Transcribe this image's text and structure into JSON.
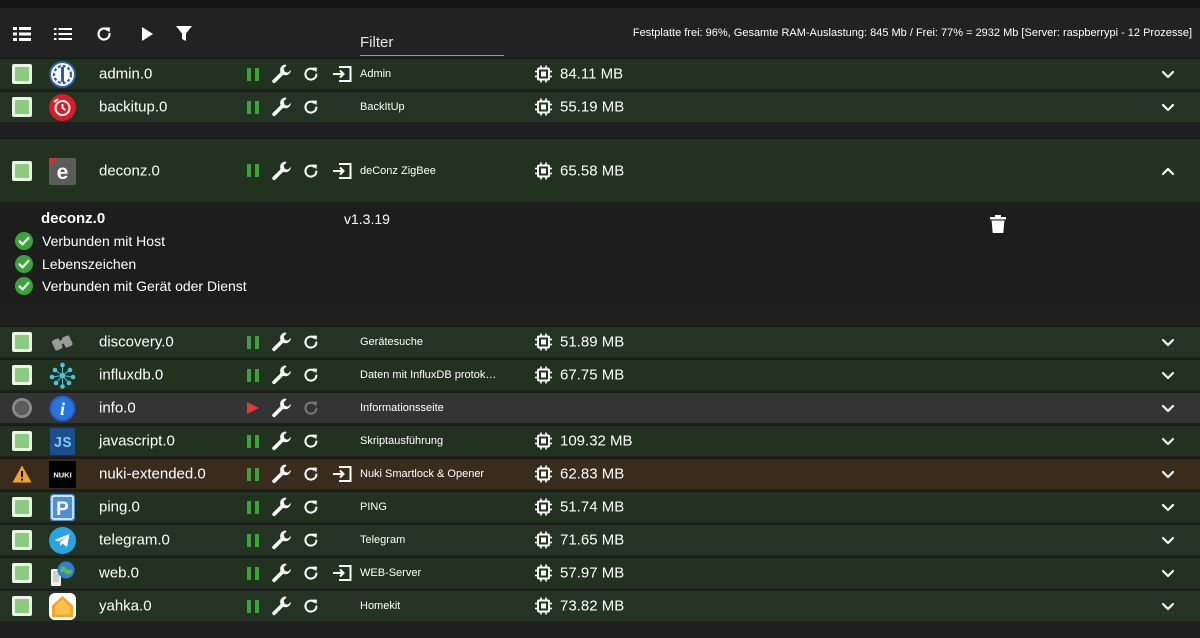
{
  "toolbar": {
    "icons": [
      "list-icon",
      "list-detail-icon",
      "refresh-icon",
      "play-icon",
      "filter-icon"
    ],
    "filter_placeholder": "Filter",
    "sysinfo": "Festplatte frei: 96%, Gesamte RAM-Auslastung: 845 Mb / Frei: 77% = 2932 Mb [Server: raspberrypi - 12 Prozesse]"
  },
  "colors": {
    "row_green": "#21321f",
    "row_green_alt": "#243323",
    "row_warning": "#3a2c1d",
    "row_disabled": "#343434",
    "status_green": "#3aa33a",
    "checkbox_green": "#8acb7f",
    "stop_red": "#e53935",
    "warning_orange": "#f0a22c"
  },
  "adapters": [
    {
      "name": "admin.0",
      "title": "Admin",
      "memory": "84.11 MB",
      "logo": "admin-logo-icon",
      "state": "running",
      "link": true
    },
    {
      "name": "backitup.0",
      "title": "BackItUp",
      "memory": "55.19 MB",
      "logo": "backitup-logo-icon",
      "state": "running",
      "link": false
    },
    {
      "name": "deconz.0",
      "title": "deConz ZigBee",
      "memory": "65.58 MB",
      "logo": "deconz-logo-icon",
      "state": "running",
      "link": true,
      "expanded": true
    },
    {
      "name": "discovery.0",
      "title": "Gerätesuche",
      "memory": "51.89 MB",
      "logo": "discovery-logo-icon",
      "state": "running",
      "link": false
    },
    {
      "name": "influxdb.0",
      "title": "Daten mit InfluxDB protokollieren",
      "memory": "67.75 MB",
      "logo": "influxdb-logo-icon",
      "state": "running",
      "link": false
    },
    {
      "name": "info.0",
      "title": "Informationsseite",
      "memory": "",
      "logo": "info-logo-icon",
      "state": "stopped",
      "link": false
    },
    {
      "name": "javascript.0",
      "title": "Skriptausführung",
      "memory": "109.32 MB",
      "logo": "javascript-logo-icon",
      "state": "running",
      "link": false
    },
    {
      "name": "nuki-extended.0",
      "title": "Nuki Smartlock & Opener",
      "memory": "62.83 MB",
      "logo": "nuki-logo-icon",
      "state": "warning",
      "link": true
    },
    {
      "name": "ping.0",
      "title": "PING",
      "memory": "51.74 MB",
      "logo": "ping-logo-icon",
      "state": "running",
      "link": false
    },
    {
      "name": "telegram.0",
      "title": "Telegram",
      "memory": "71.65 MB",
      "logo": "telegram-logo-icon",
      "state": "running",
      "link": false
    },
    {
      "name": "web.0",
      "title": "WEB-Server",
      "memory": "57.97 MB",
      "logo": "web-logo-icon",
      "state": "running",
      "link": true
    },
    {
      "name": "yahka.0",
      "title": "Homekit",
      "memory": "73.82 MB",
      "logo": "yahka-logo-icon",
      "state": "running",
      "link": false
    }
  ],
  "detail": {
    "name": "deconz.0",
    "version": "v1.3.19",
    "statuses": [
      "Verbunden mit Host",
      "Lebenszeichen",
      "Verbunden mit Gerät oder Dienst"
    ]
  },
  "logo_texts": {
    "deconz": "e",
    "javascript": "JS",
    "nuki": "NUKI",
    "ping": "P",
    "info": "i"
  }
}
